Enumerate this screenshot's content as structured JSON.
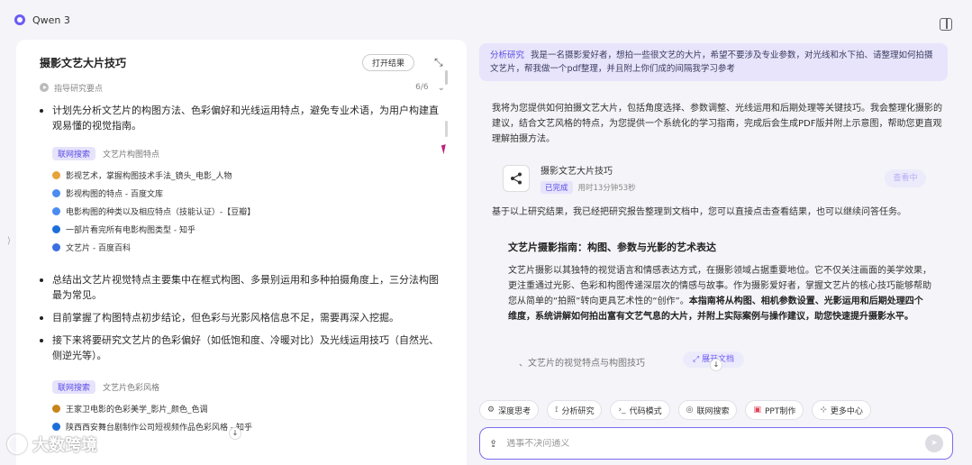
{
  "app": {
    "title": "Qwen 3"
  },
  "left": {
    "title": "摄影文艺大片技巧",
    "open_label": "打开结果",
    "progress_label": "指导研究要点",
    "progress_count": "6/6",
    "bullets_top": [
      "计划先分析文艺片的构图方法、色彩偏好和光线运用特点，避免专业术语，为用户构建直观易懂的视觉指南。"
    ],
    "search1": {
      "chip": "联网搜索",
      "query": "文艺片构图特点",
      "results": [
        "影视艺术，掌握构图技术手法_镜头_电影_人物",
        "影视构图的特点 - 百度文库",
        "电影构图的种类以及相应特点（技能认证）-【豆瓣】",
        "一部片看完所有电影构图类型 - 知乎",
        "文艺片 - 百度百科"
      ]
    },
    "bullets_mid": [
      "总结出文艺片视觉特点主要集中在框式构图、多景别运用和多种拍摄角度上，三分法构图最为常见。",
      "目前掌握了构图特点初步结论，但色彩与光影风格信息不足，需要再深入挖掘。",
      "接下来将要研究文艺片的色彩偏好（如低饱和度、冷暖对比）及光线运用技巧（自然光、侧逆光等）。"
    ],
    "search2": {
      "chip": "联网搜索",
      "query": "文艺片色彩风格",
      "results": [
        "王家卫电影的色彩美学_影片_颜色_色调",
        "陕西西安舞台剧制作公司短视频作品色彩风格 - 知乎"
      ]
    }
  },
  "watermark": {
    "text": "大数跨境"
  },
  "right": {
    "query_tag": "分析研究",
    "query_text": "我是一名摄影爱好者，想拍一些很文艺的大片，希望不要涉及专业参数，对光线和水下拍、请整理如何拍摄文艺片，帮我做一个pdf整理，并且附上你们成的间隔我学习参考",
    "intro": "我将为您提供如何拍摄文艺大片，包括角度选择、参数调整、光线运用和后期处理等关键技巧。我会整理化摄影的建议，结合文艺风格的特点，为您提供一个系统化的学习指南，完成后会生成PDF版并附上示意图，帮助您更直观理解拍摄方法。",
    "doc_card": {
      "title": "摄影文艺大片技巧",
      "status": "已完成",
      "time": "用时13分钟53秒",
      "view_label": "查看中"
    },
    "follow": "基于以上研究结果，我已经把研究报告整理到文档中，您可以直接点击查看结果，也可以继续问答任务。",
    "article_title": "文艺片摄影指南：构图、参数与光影的艺术表达",
    "article_p1": "文艺片摄影以其独特的视觉语言和情感表达方式，在摄影领域占据重要地位。它不仅关注画面的美学效果，更注重通过光影、色彩和构图传递深层次的情感与故事。作为摄影爱好者，掌握文艺片的核心技巧能够帮助您从简单的“拍照”转向更具艺术性的“创作”。",
    "article_p2": "本指南将从构图、相机参数设置、光影运用和后期处理四个维度，系统讲解如何拍出富有文艺气息的大片，并附上实际案例与操作建议，助您快速提升摄影水平。",
    "sub_item": "、文艺片的视觉特点与构图技巧",
    "expand_doc": "展开文档",
    "tools": [
      {
        "icon": "deep-think-icon",
        "glyph": "⚙",
        "label": "深度思考"
      },
      {
        "icon": "research-icon",
        "glyph": "⟟",
        "label": "分析研究"
      },
      {
        "icon": "code-icon",
        "glyph": "›_",
        "label": "代码模式"
      },
      {
        "icon": "search-icon",
        "glyph": "◎",
        "label": "联网搜索"
      },
      {
        "icon": "ppt-icon",
        "glyph": "▣",
        "label": "PPT制作"
      },
      {
        "icon": "more-icon",
        "glyph": "⊹",
        "label": "更多中心"
      }
    ],
    "input_placeholder": "遇事不决问通义"
  },
  "colors": {
    "accent": "#6b5bf5",
    "chip_bg": "#e6e3fb",
    "bg": "#f4f4f9"
  }
}
